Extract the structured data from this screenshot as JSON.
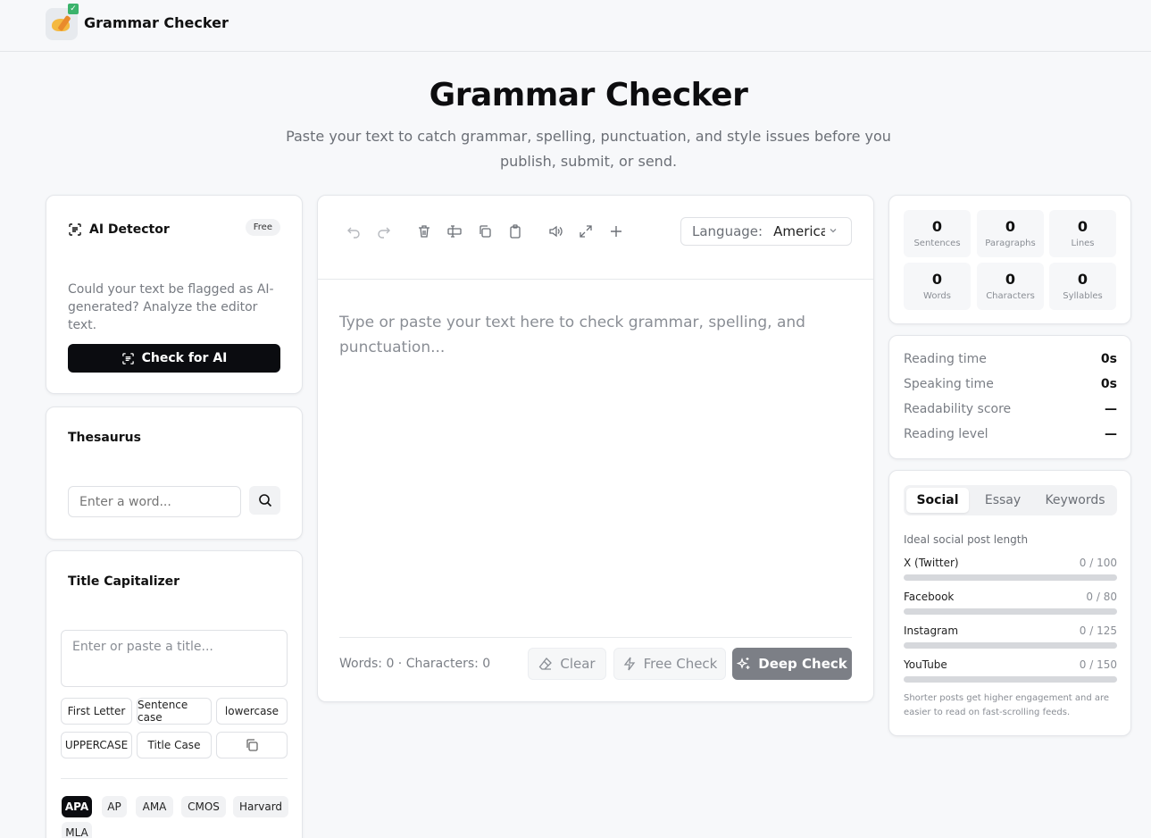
{
  "header": {
    "brand": "Grammar Checker"
  },
  "hero": {
    "title": "Grammar Checker",
    "subtitle": "Paste your text to catch grammar, spelling, punctuation, and style issues before you publish, submit, or send."
  },
  "ai_detector": {
    "title": "AI Detector",
    "badge": "Free",
    "description": "Could your text be flagged as AI-generated? Analyze the editor text.",
    "button": "Check for AI"
  },
  "thesaurus": {
    "title": "Thesaurus",
    "placeholder": "Enter a word..."
  },
  "title_capitalizer": {
    "title": "Title Capitalizer",
    "placeholder": "Enter or paste a title...",
    "buttons": [
      "First Letter",
      "Sentence case",
      "lowercase",
      "UPPERCASE",
      "Title Case"
    ],
    "styles": [
      "APA",
      "AP",
      "AMA",
      "CMOS",
      "Harvard",
      "MLA"
    ],
    "active_style": "APA"
  },
  "editor": {
    "language_label": "Language:",
    "language_value": "American",
    "placeholder": "Type or paste your text here to check grammar, spelling, and punctuation...",
    "counts": "Words: 0 · Characters: 0",
    "clear": "Clear",
    "free_check": "Free Check",
    "deep_check": "Deep Check"
  },
  "stats": [
    {
      "value": "0",
      "label": "Sentences"
    },
    {
      "value": "0",
      "label": "Paragraphs"
    },
    {
      "value": "0",
      "label": "Lines"
    },
    {
      "value": "0",
      "label": "Words"
    },
    {
      "value": "0",
      "label": "Characters"
    },
    {
      "value": "0",
      "label": "Syllables"
    }
  ],
  "reading": [
    {
      "label": "Reading time",
      "value": "0s"
    },
    {
      "label": "Speaking time",
      "value": "0s"
    },
    {
      "label": "Readability score",
      "value": "—"
    },
    {
      "label": "Reading level",
      "value": "—"
    }
  ],
  "social": {
    "tabs": [
      "Social",
      "Essay",
      "Keywords"
    ],
    "active_tab": "Social",
    "heading": "Ideal social post length",
    "platforms": [
      {
        "name": "X (Twitter)",
        "limit": "0 / 100",
        "progress": 0
      },
      {
        "name": "Facebook",
        "limit": "0 / 80",
        "progress": 0
      },
      {
        "name": "Instagram",
        "limit": "0 / 125",
        "progress": 0
      },
      {
        "name": "YouTube",
        "limit": "0 / 150",
        "progress": 0
      }
    ],
    "note": "Shorter posts get higher engagement and are easier to read on fast-scrolling feeds."
  },
  "colors": {
    "primary": "#0b0c10",
    "deep_check": "#7c7f86",
    "bar_track": "#d6d8dc"
  }
}
